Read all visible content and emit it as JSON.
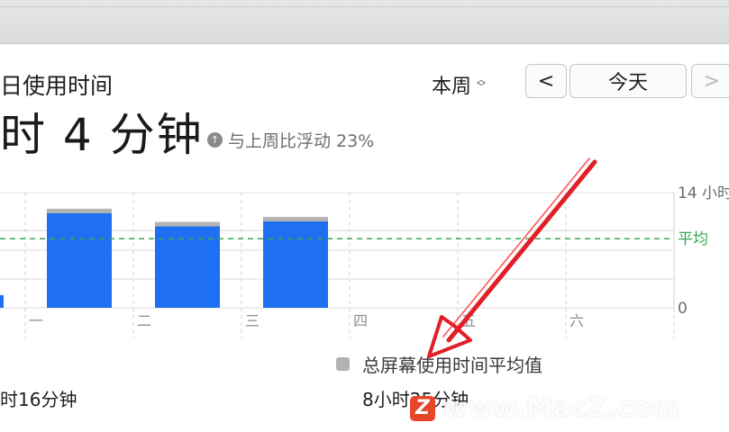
{
  "header": {
    "title": "日使用时间",
    "total": "时 4 分钟",
    "compare_text": "与上周比浮动 23%",
    "compare_icon": "arrow-up-circle-icon"
  },
  "controls": {
    "period": "本周",
    "prev_label": "<",
    "today_label": "今天",
    "next_label": ">"
  },
  "chart_data": {
    "type": "bar",
    "categories": [
      "一",
      "二",
      "三",
      "四",
      "五",
      "六"
    ],
    "values": [
      11.6,
      10.0,
      10.6,
      0,
      0,
      0
    ],
    "y_ticks": [
      "14 小时",
      "0"
    ],
    "average_label": "平均",
    "average_value": 8.4,
    "ylim": [
      0,
      14
    ],
    "bar_color": "#1f6ff2",
    "cap_color": "#b3b3b3",
    "average_color": "#34a853",
    "grid": true
  },
  "legend": {
    "label": "总屏幕使用时间平均值"
  },
  "stats": {
    "left_value": "时16分钟",
    "right_value": "8小时25分钟"
  },
  "watermark": {
    "logo": "Z",
    "text": "www.MacZ.com"
  }
}
